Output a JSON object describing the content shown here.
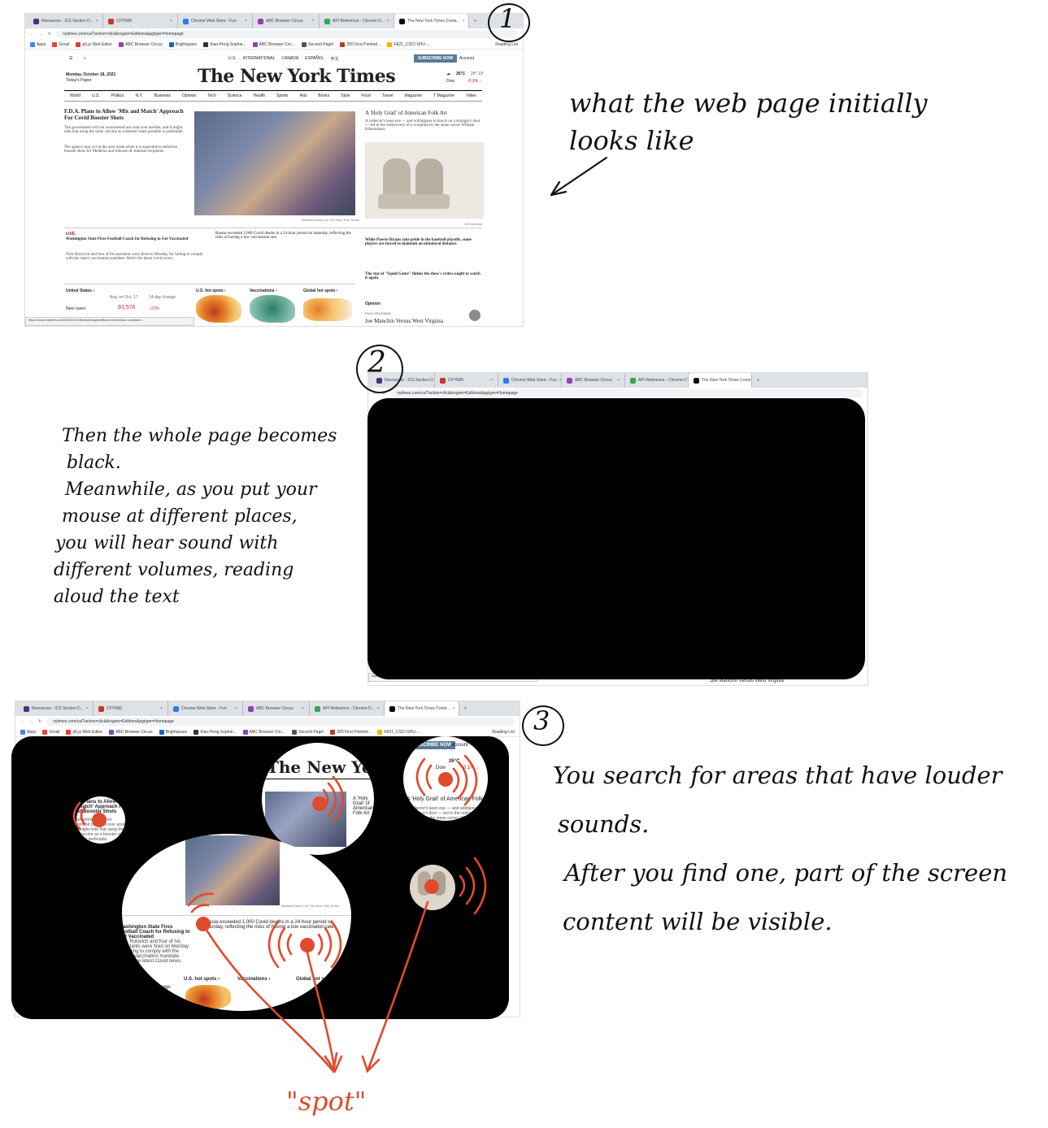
{
  "annotations": {
    "step1_number": "1",
    "step2_number": "2",
    "step3_number": "3",
    "note1_lines": [
      "what the web page initially",
      "looks like"
    ],
    "note2_lines": [
      "Then the whole page becomes",
      "black.",
      "Meanwhile, as you put your",
      "mouse at different places,",
      "you will hear sound with",
      "different volumes, reading",
      "aloud the text"
    ],
    "note3_lines": [
      "You search for areas that have louder",
      "sounds.",
      "After you find one, part of the screen",
      "content will be visible."
    ],
    "spot_label": "\"spot\""
  },
  "browser": {
    "tabs": [
      "Resources - ICS Section D...",
      "CFYN00",
      "Chrome Web Store - Fun",
      "ABC Browser Circus",
      "API Reference - Chrome D...",
      "The New York Times Conte..."
    ],
    "tabs_short": [
      "Resources - ICS Section D",
      "CFYN00",
      "Chrome Web Store - Fun",
      "ABC Browser Circus",
      "API Reference - Chrome D",
      "The New York Times Conte"
    ],
    "url": "nytimes.com/ca/?action=click&region=Editions&pgtype=Homepage",
    "bookmarks": [
      "Apps",
      "Gmail",
      "p5.js Web Editor",
      "ABC Browser Circus",
      "Brightspace",
      "Xiao-Peng Sophie...",
      "ABC Browser Circ...",
      "Second Page!",
      "265 First Pointed...",
      "FA21_CSCI-SHU-..."
    ],
    "reading_list": "Reading List",
    "status_url": "https://www.nytimes.com/2021/10/18/arts/design/william-edmondson-sculpture..."
  },
  "nyt": {
    "editions": [
      "U.S.",
      "INTERNATIONAL",
      "CANADA",
      "ESPAÑOL",
      "中文"
    ],
    "subscribe": "SUBSCRIBE NOW",
    "account": "Account",
    "date": "Monday, October 18, 2021",
    "todays_paper": "Today's Paper",
    "masthead": "The New York Times",
    "weather_temp": "26°C",
    "weather_range": "28° 19°",
    "market_label": "Dow",
    "market_change": "-0.1% ↓",
    "sections": [
      "World",
      "U.S.",
      "Politics",
      "N.Y.",
      "Business",
      "Opinion",
      "Tech",
      "Science",
      "Health",
      "Sports",
      "Arts",
      "Books",
      "Style",
      "Food",
      "Travel",
      "Magazine",
      "T Magazine",
      "Video"
    ],
    "lead_headline": "F.D.A. Plans to Allow 'Mix and Match' Approach For Covid Booster Shots",
    "lead_bullet1": "The government will not recommend one shot over another, and it might note that using the same vaccine as a booster when possible is preferable.",
    "lead_bullet2": "The agency may act in the next week when it is expected to authorize booster shots for Moderna and Johnson & Johnson recipients.",
    "photo_credit": "Matthew Busch for The New York Times",
    "folk_headline": "A 'Holy Grail' of American Folk Art",
    "folk_summary": "A collector's keen eye — and willingness to knock on a stranger's door — led to the rediscovery of a sculpture by the stone carver William Edmondson.",
    "folk_credit": "Jill Nordman",
    "live_label": "LIVE",
    "coach_headline": "Washington State Fires Football Coach for Refusing to Get Vaccinated",
    "coach_summary": "Nick Rolovich and four of his assistants were fired on Monday for failing to comply with the state's vaccination mandate. Here's the latest Covid news.",
    "russia_summary": "Russia exceeded 1,000 Covid deaths in a 24-hour period on Saturday, reflecting the risks of having a low vaccination rate.",
    "puerto_headline": "While Puerto Ricans take pride in the baseball playoffs, some players are forced to maintain an unnatural distance.",
    "squid_headline": "The star of \"Squid Game\" thinks the show's critics ought to watch it again.",
    "us_states": "United States ›",
    "avg_label": "Avg. on Oct. 17",
    "change_label": "14-day change",
    "new_cases_label": "New cases",
    "new_cases_value": "83,576",
    "new_cases_change": "−22%",
    "hotspots_us": "U.S. hot spots ›",
    "vaccinations": "Vaccinations ›",
    "hotspots_global": "Global hot spots ›",
    "opinion_label": "Opinion",
    "opinion_author": "PAUL KRUGMAN",
    "opinion_headline": "Joe Manchin Versus West Virginia"
  },
  "colors": {
    "spot_red": "#e04a2f",
    "nyt_red": "#d0021b",
    "subscribe_blue": "#567b95",
    "blackout": "#000000"
  }
}
